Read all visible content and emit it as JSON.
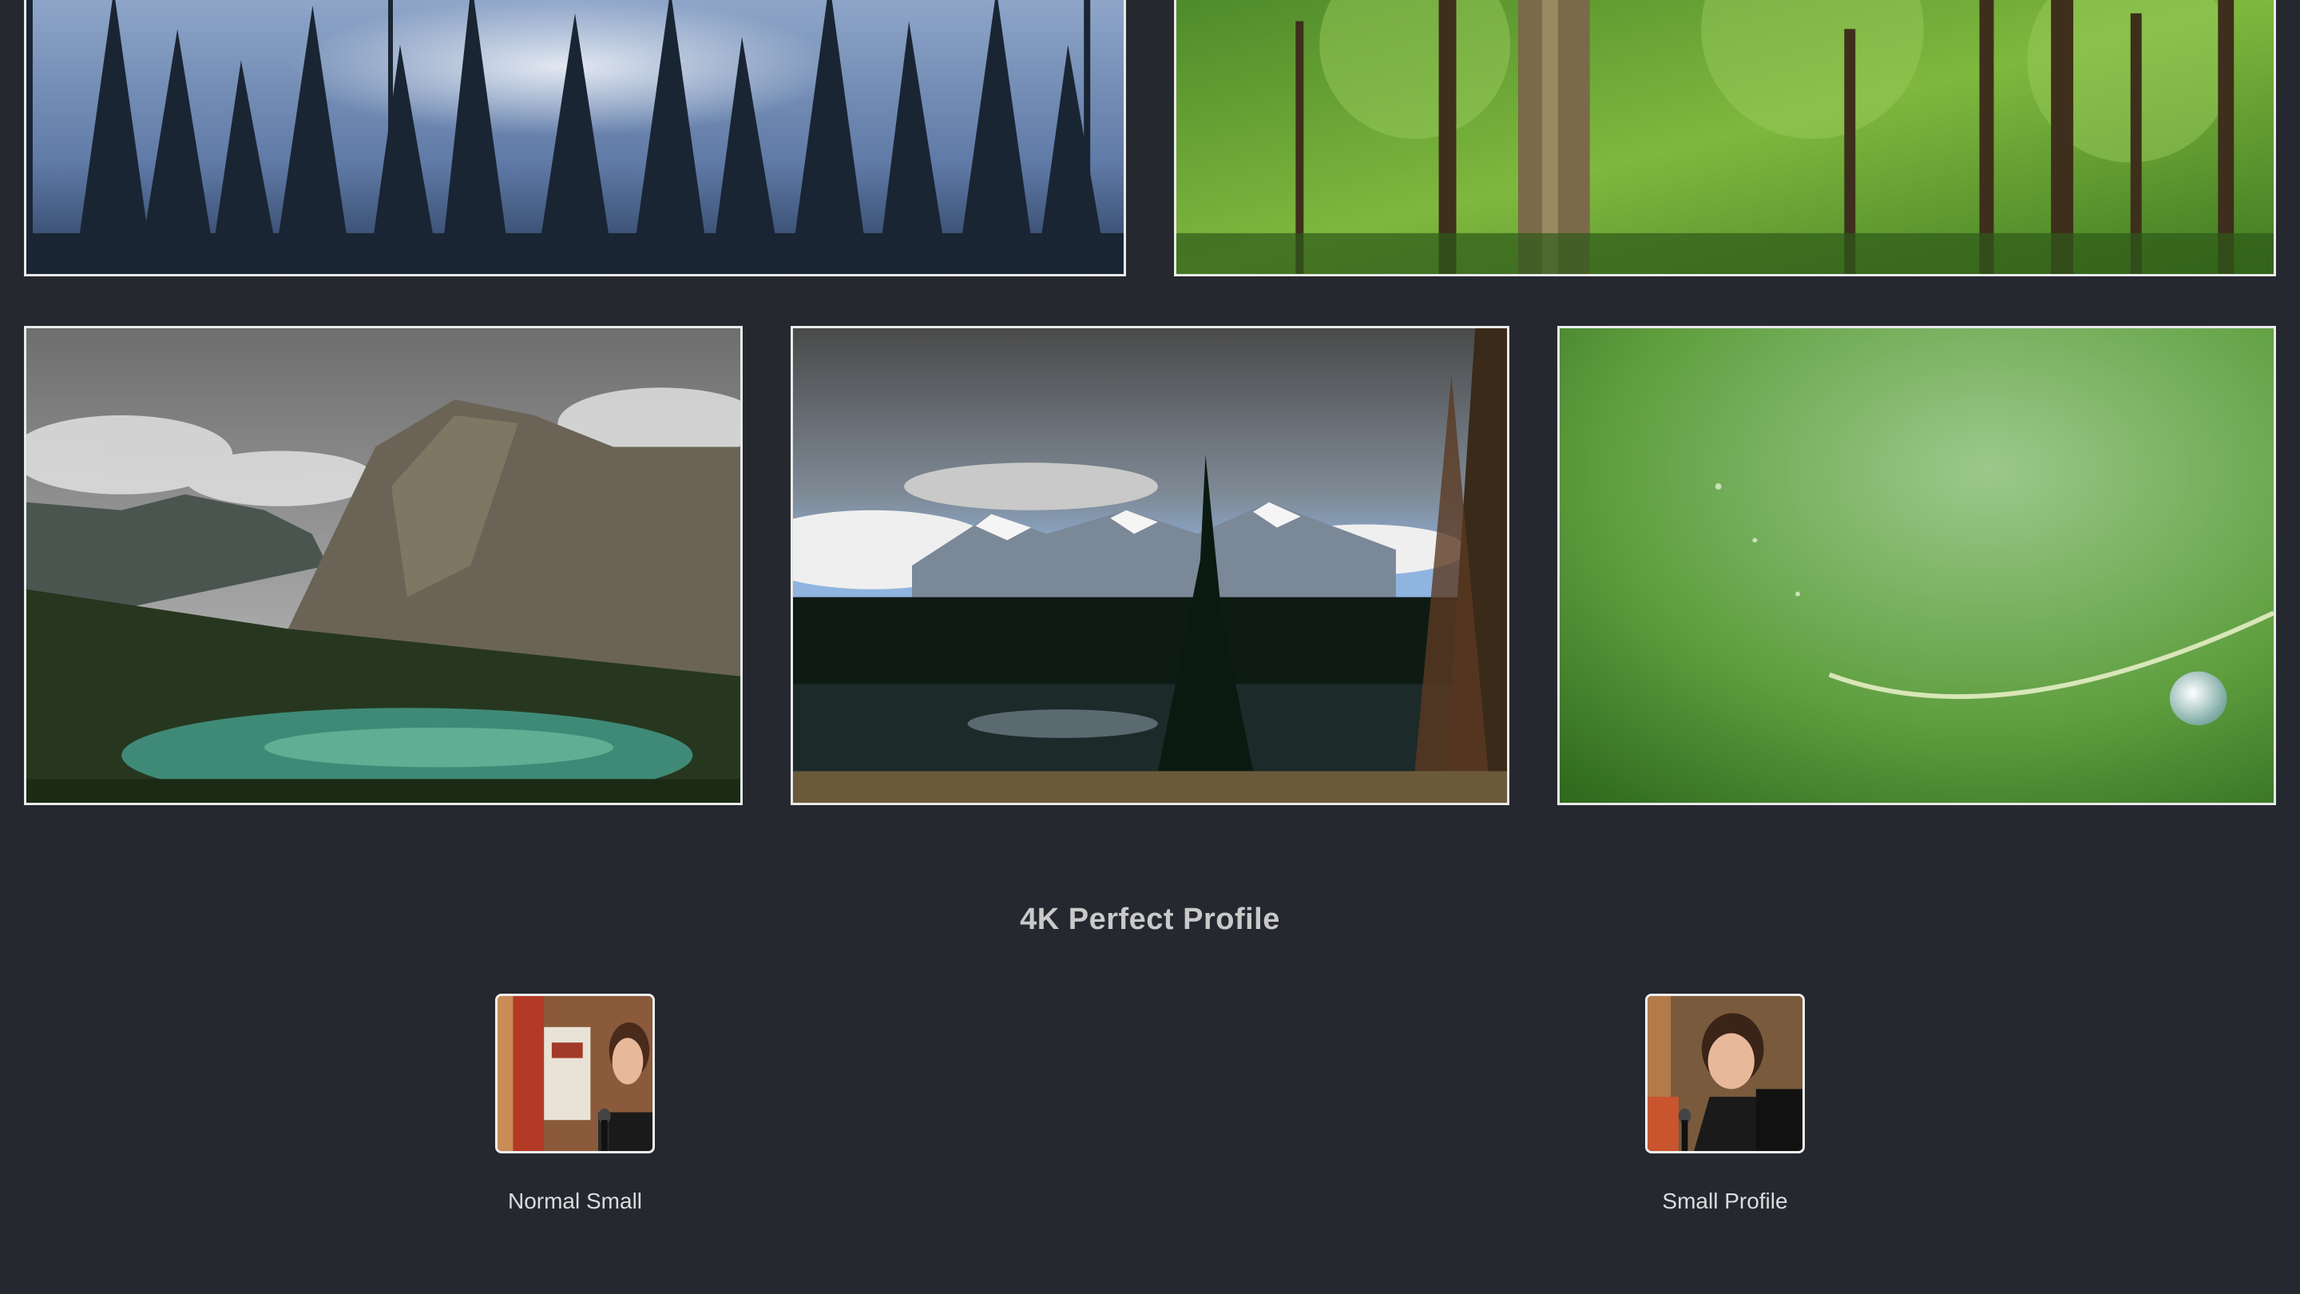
{
  "gallery": {
    "photos": [
      {
        "alt": "forest-silhouette-photo"
      },
      {
        "alt": "green-forest-photo"
      },
      {
        "alt": "mountain-lake-photo"
      },
      {
        "alt": "snowy-mountains-photo"
      },
      {
        "alt": "dewdrop-macro-photo"
      }
    ]
  },
  "profile_section": {
    "title": "4K Perfect Profile",
    "items": [
      {
        "caption": "Normal Small"
      },
      {
        "caption": "Small Profile"
      }
    ]
  }
}
